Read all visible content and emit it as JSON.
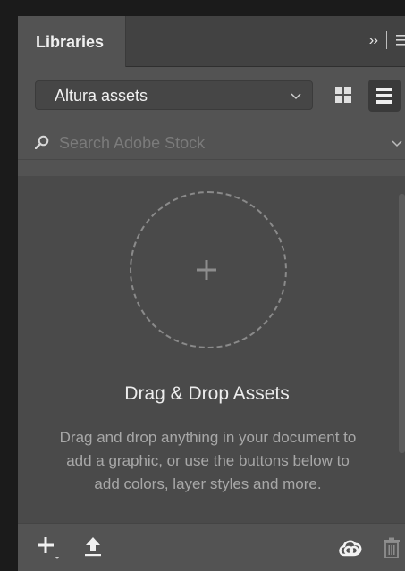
{
  "panel": {
    "tab_label": "Libraries",
    "collapse_glyph": "››"
  },
  "library_select": {
    "selected": "Altura assets"
  },
  "search": {
    "placeholder": "Search Adobe Stock"
  },
  "empty_state": {
    "title": "Drag & Drop Assets",
    "description": "Drag and drop anything in your document to add a graphic, or use the buttons below to add colors, layer styles and more."
  },
  "icons": {
    "collapse": "double-chevron-right-icon",
    "panel_menu": "hamburger-menu-icon",
    "grid_view": "grid-view-icon",
    "list_view": "list-view-icon",
    "search": "search-icon",
    "add": "plus-icon",
    "upload": "upload-icon",
    "creative_cloud": "creative-cloud-icon",
    "trash": "trash-icon"
  },
  "colors": {
    "panel_bg": "#535353",
    "content_bg": "#4a4a4a",
    "text": "#ececec"
  }
}
